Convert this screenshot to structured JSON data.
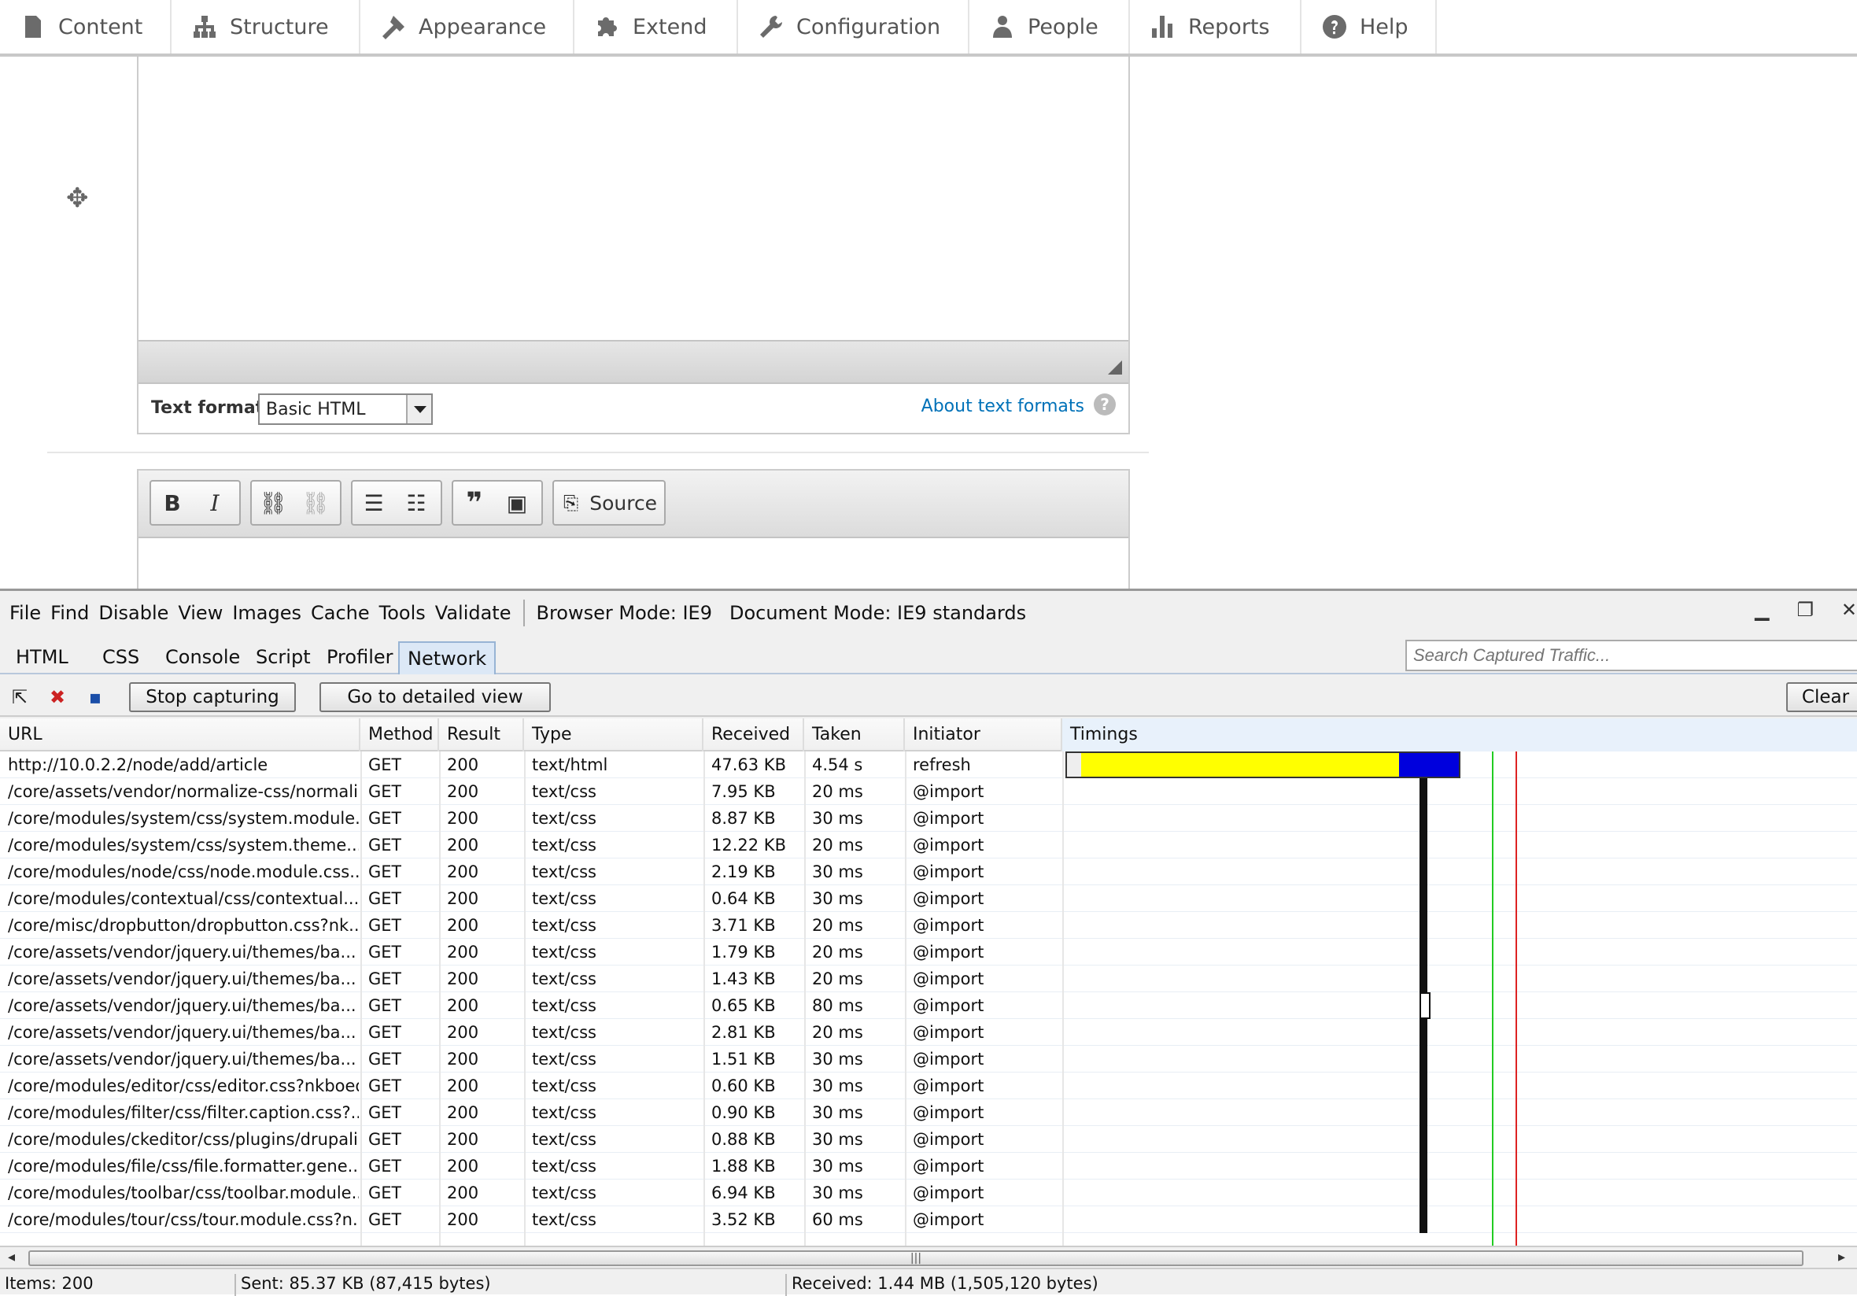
{
  "toolbar": {
    "items": [
      {
        "label": "Content",
        "icon": "content-icon"
      },
      {
        "label": "Structure",
        "icon": "structure-icon"
      },
      {
        "label": "Appearance",
        "icon": "appearance-icon"
      },
      {
        "label": "Extend",
        "icon": "extend-icon"
      },
      {
        "label": "Configuration",
        "icon": "configuration-icon"
      },
      {
        "label": "People",
        "icon": "people-icon"
      },
      {
        "label": "Reports",
        "icon": "reports-icon"
      },
      {
        "label": "Help",
        "icon": "help-icon"
      }
    ]
  },
  "editor": {
    "text_format_label": "Text format",
    "text_format_value": "Basic HTML",
    "about_link": "About text formats",
    "help_glyph": "?",
    "source_label": "Source",
    "bold_label": "B",
    "italic_label": "I"
  },
  "devtools": {
    "menu": [
      "File",
      "Find",
      "Disable",
      "View",
      "Images",
      "Cache",
      "Tools",
      "Validate"
    ],
    "browser_mode": "Browser Mode:  IE9",
    "document_mode": "Document Mode:  IE9 standards",
    "tabs": [
      "HTML",
      "CSS",
      "Console",
      "Script",
      "Profiler",
      "Network"
    ],
    "active_tab": "Network",
    "search_placeholder": "Search Captured Traffic...",
    "stop_capturing": "Stop capturing",
    "detailed_view": "Go to detailed view",
    "clear": "Clear",
    "columns": [
      "URL",
      "Method",
      "Result",
      "Type",
      "Received",
      "Taken",
      "Initiator",
      "Timings"
    ],
    "rows": [
      [
        "http://10.0.2.2/node/add/article",
        "GET",
        "200",
        "text/html",
        "47.63 KB",
        "4.54 s",
        "refresh"
      ],
      [
        "/core/assets/vendor/normalize-css/normali...",
        "GET",
        "200",
        "text/css",
        "7.95 KB",
        "20 ms",
        "@import"
      ],
      [
        "/core/modules/system/css/system.module...",
        "GET",
        "200",
        "text/css",
        "8.87 KB",
        "30 ms",
        "@import"
      ],
      [
        "/core/modules/system/css/system.theme....",
        "GET",
        "200",
        "text/css",
        "12.22 KB",
        "20 ms",
        "@import"
      ],
      [
        "/core/modules/node/css/node.module.css...",
        "GET",
        "200",
        "text/css",
        "2.19 KB",
        "30 ms",
        "@import"
      ],
      [
        "/core/modules/contextual/css/contextual....",
        "GET",
        "200",
        "text/css",
        "0.64 KB",
        "30 ms",
        "@import"
      ],
      [
        "/core/misc/dropbutton/dropbutton.css?nk...",
        "GET",
        "200",
        "text/css",
        "3.71 KB",
        "20 ms",
        "@import"
      ],
      [
        "/core/assets/vendor/jquery.ui/themes/ba...",
        "GET",
        "200",
        "text/css",
        "1.79 KB",
        "20 ms",
        "@import"
      ],
      [
        "/core/assets/vendor/jquery.ui/themes/ba...",
        "GET",
        "200",
        "text/css",
        "1.43 KB",
        "20 ms",
        "@import"
      ],
      [
        "/core/assets/vendor/jquery.ui/themes/ba...",
        "GET",
        "200",
        "text/css",
        "0.65 KB",
        "80 ms",
        "@import"
      ],
      [
        "/core/assets/vendor/jquery.ui/themes/ba...",
        "GET",
        "200",
        "text/css",
        "2.81 KB",
        "20 ms",
        "@import"
      ],
      [
        "/core/assets/vendor/jquery.ui/themes/ba...",
        "GET",
        "200",
        "text/css",
        "1.51 KB",
        "30 ms",
        "@import"
      ],
      [
        "/core/modules/editor/css/editor.css?nkboeq",
        "GET",
        "200",
        "text/css",
        "0.60 KB",
        "30 ms",
        "@import"
      ],
      [
        "/core/modules/filter/css/filter.caption.css?...",
        "GET",
        "200",
        "text/css",
        "0.90 KB",
        "30 ms",
        "@import"
      ],
      [
        "/core/modules/ckeditor/css/plugins/drupali...",
        "GET",
        "200",
        "text/css",
        "0.88 KB",
        "30 ms",
        "@import"
      ],
      [
        "/core/modules/file/css/file.formatter.gene...",
        "GET",
        "200",
        "text/css",
        "1.88 KB",
        "30 ms",
        "@import"
      ],
      [
        "/core/modules/toolbar/css/toolbar.module...",
        "GET",
        "200",
        "text/css",
        "6.94 KB",
        "30 ms",
        "@import"
      ],
      [
        "/core/modules/tour/css/tour.module.css?n...",
        "GET",
        "200",
        "text/css",
        "3.52 KB",
        "60 ms",
        "@import"
      ]
    ],
    "status": {
      "items": "Items: 200",
      "sent": "Sent: 85.37 KB (87,415 bytes)",
      "received": "Received: 1.44 MB (1,505,120 bytes)"
    },
    "colors": {
      "timing_wait": "#ffff00",
      "timing_receive": "#0000dd",
      "dom_line": "#22cc22",
      "load_line": "#dd2222"
    }
  }
}
